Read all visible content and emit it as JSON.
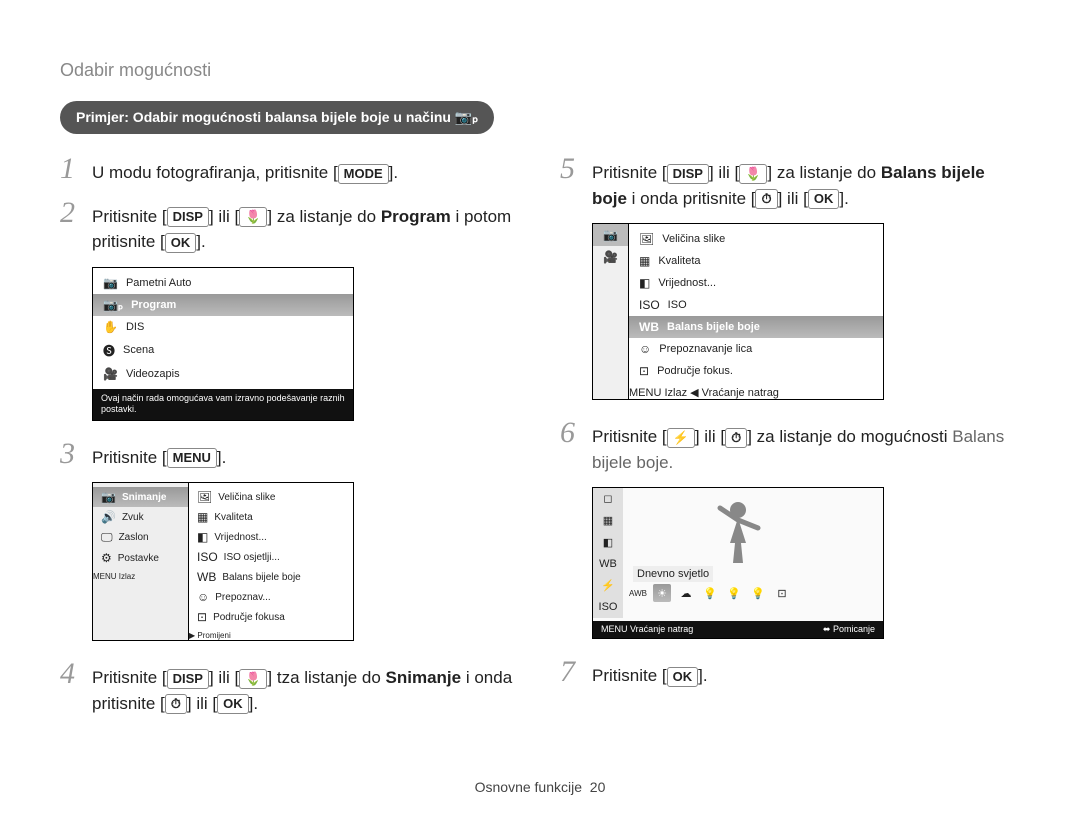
{
  "header": "Odabir mogućnosti",
  "examplePill": "Primjer: Odabir mogućnosti balansa bijele boje u načinu ",
  "examplePillIcon": "📷ₚ",
  "steps": {
    "s1": {
      "num": "1",
      "pre": "U modu fotografiranja, pritisnite [",
      "key": "MODE",
      "post": "]."
    },
    "s2": {
      "num": "2",
      "a": "Pritisnite [",
      "k1": "DISP",
      "b": "] ili [",
      "k2": "🌷",
      "c": "]  za listanje do ",
      "bold": "Program",
      "d": " i potom pritisnite [",
      "k3": "OK",
      "e": "]."
    },
    "s3": {
      "num": "3",
      "a": "Pritisnite [",
      "k": "MENU",
      "b": "]."
    },
    "s4": {
      "num": "4",
      "a": "Pritisnite [",
      "k1": "DISP",
      "b": "] ili [",
      "k2": "🌷",
      "c": "] tza listanje do ",
      "bold": "Snimanje",
      "d": " i onda pritisnite [",
      "k3": "⏱",
      "e": "] ili [",
      "k4": "OK",
      "f": "]."
    },
    "s5": {
      "num": "5",
      "a": "Pritisnite [",
      "k1": "DISP",
      "b": "] ili [",
      "k2": "🌷",
      "c": "] za listanje do ",
      "bold": "Balans bijele boje",
      "d": " i onda pritisnite [",
      "k3": "⏱",
      "e": "] ili [",
      "k4": "OK",
      "f": "]."
    },
    "s6": {
      "num": "6",
      "a": "Pritisnite [",
      "k1": "⚡",
      "b": "] ili [",
      "k2": "⏱",
      "c": "] za listanje do mogućnosti ",
      "tail": "Balans bijele boje."
    },
    "s7": {
      "num": "7",
      "a": "Pritisnite [",
      "k": "OK",
      "b": "]."
    }
  },
  "lcd1": {
    "items": [
      "Pametni Auto",
      "Program",
      "DIS",
      "Scena",
      "Videozapis"
    ],
    "selectedIndex": 1,
    "icons": [
      "📷",
      "📷ₚ",
      "✋",
      "🅢",
      "🎥"
    ],
    "hint": "Ovaj način rada omogućava vam izravno podešavanje raznih postavki."
  },
  "lcd2": {
    "left": [
      "Snimanje",
      "Zvuk",
      "Zaslon",
      "Postavke"
    ],
    "leftIcons": [
      "📷",
      "🔊",
      "🖵",
      "⚙"
    ],
    "leftSelected": 0,
    "right": [
      "Veličina slike",
      "Kvaliteta",
      "Vrijednost...",
      "ISO osjetlji...",
      "Balans bijele boje",
      "Prepoznav...",
      "Područje fokusa"
    ],
    "rightIcons": [
      "🖼",
      "▦",
      "◧",
      "ISO",
      "WB",
      "☺",
      "⊡"
    ],
    "exit": "Izlaz",
    "change": "Promijeni",
    "exitKey": "MENU",
    "changeKey": "▶"
  },
  "lcd3": {
    "leftIcons": [
      "📷",
      "🎥"
    ],
    "leftSelected": 0,
    "items": [
      "Veličina slike",
      "Kvaliteta",
      "Vrijednost...",
      "ISO",
      "Balans bijele boje",
      "Prepoznavanje lica",
      "Područje fokus."
    ],
    "icons": [
      "🖼",
      "▦",
      "◧",
      "ISO",
      "WB",
      "☺",
      "⊡"
    ],
    "selectedIndex": 4,
    "exit": "Izlaz",
    "back": "Vraćanje natrag",
    "exitKey": "MENU",
    "backKey": "◀"
  },
  "lcd4": {
    "stripIcons": [
      "◻",
      "▦",
      "◧",
      "WB",
      "⚡",
      "ISO"
    ],
    "label": "Dnevno svjetlo",
    "rowIcons": [
      "AWB",
      "☀",
      "☁",
      "💡",
      "💡",
      "💡",
      "⊡"
    ],
    "rowSelected": 1,
    "back": "Vraćanje natrag",
    "move": "Pomicanje",
    "backKey": "MENU",
    "moveKey": "⬌"
  },
  "footer": {
    "section": "Osnovne funkcije",
    "page": "20"
  }
}
